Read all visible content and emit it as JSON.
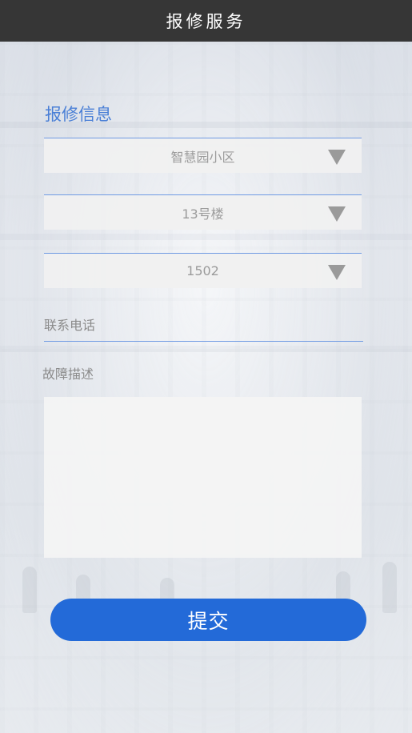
{
  "header": {
    "title": "报修服务"
  },
  "form": {
    "section_title": "报修信息",
    "community": {
      "value": "智慧园小区"
    },
    "building": {
      "value": "13号楼"
    },
    "room": {
      "value": "1502"
    },
    "phone": {
      "placeholder": "联系电话"
    },
    "description": {
      "label": "故障描述"
    }
  },
  "actions": {
    "submit_label": "提交"
  },
  "colors": {
    "title_bar": "#363636",
    "accent": "#4a7fd6",
    "submit_button": "#236ad8"
  },
  "icons": [
    "triangle-down-icon"
  ]
}
